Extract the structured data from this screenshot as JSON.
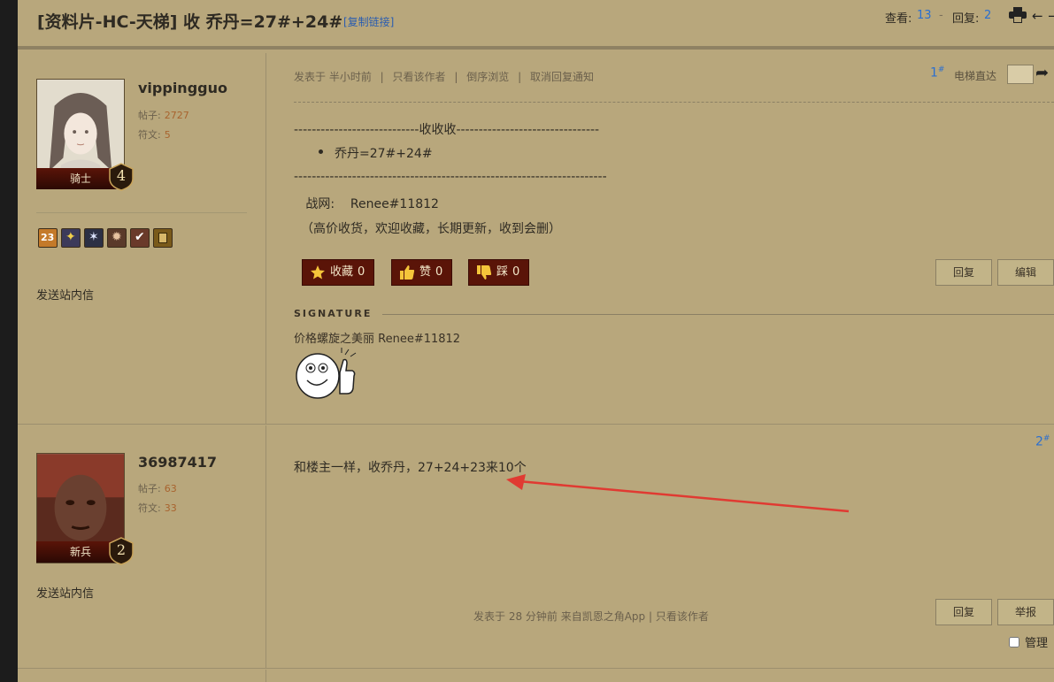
{
  "header": {
    "title": "[资料片-HC-天梯] 收 乔丹=27#+24#",
    "copy_link": "[复制链接]",
    "views_label": "查看:",
    "views": "13",
    "sep": "-",
    "replies_label": "回复:",
    "replies": "2"
  },
  "post1": {
    "username": "vippingguo",
    "posts_label": "帖子:",
    "posts": "2727",
    "runes_label": "符文:",
    "runes": "5",
    "rank": "骑士",
    "level": "4",
    "badge_num": "23",
    "pm": "发送站内信",
    "meta": {
      "posted": "发表于 半小时前",
      "sep1": "|",
      "author_only": "只看该作者",
      "sep2": "|",
      "reverse": "倒序浏览",
      "sep3": "|",
      "cancel_notify": "取消回复通知"
    },
    "floor": "1",
    "floor_sup": "#",
    "elevator": "电梯直达",
    "body": {
      "line1": "----------------------------收收收--------------------------------",
      "item1": "乔丹=27#+24#",
      "line2": "----------------------------------------------------------------------",
      "bnet": "   战网:    Renee#11812",
      "note": "（高价收货，欢迎收藏，长期更新，收到会删）"
    },
    "fav": "收藏",
    "fav_count": "0",
    "like": "赞",
    "like_count": "0",
    "dislike": "踩",
    "dislike_count": "0",
    "reply_btn": "回复",
    "edit_btn": "编辑",
    "signature_label": "SIGNATURE",
    "signature_text": "价格螺旋之美丽 Renee#11812"
  },
  "post2": {
    "username": "36987417",
    "posts_label": "帖子:",
    "posts": "63",
    "runes_label": "符文:",
    "runes": "33",
    "rank": "新兵",
    "level": "2",
    "pm": "发送站内信",
    "floor": "2",
    "floor_sup": "#",
    "body": "和楼主一样，收乔丹，27+24+23来10个",
    "meta_posted": "发表于 28 分钟前 来自凯恩之角App",
    "meta_sep": "|",
    "meta_author_only": "只看该作者",
    "reply_btn": "回复",
    "report_btn": "举报",
    "manage": "管理"
  },
  "colors": {
    "background": "#b8a77c",
    "accent_dark_red": "#5a1408",
    "link_blue": "#2a6fd0",
    "annotation_arrow": "#e03a32"
  }
}
